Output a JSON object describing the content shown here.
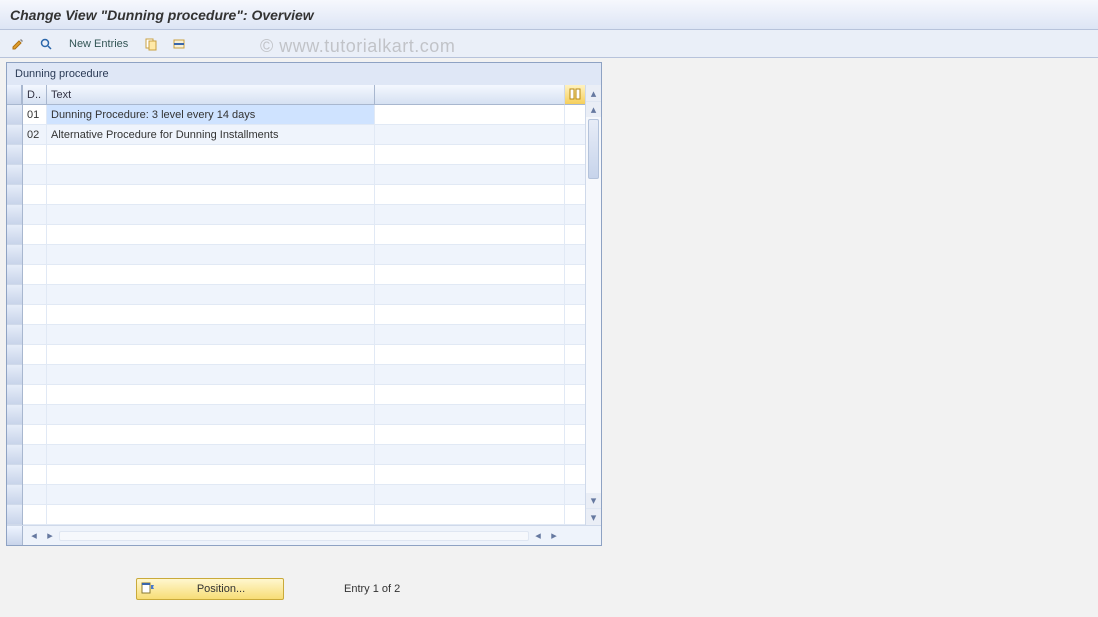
{
  "title": "Change View \"Dunning procedure\": Overview",
  "watermark": "© www.tutorialkart.com",
  "toolbar": {
    "new_entries_label": "New Entries"
  },
  "panel": {
    "title": "Dunning procedure"
  },
  "columns": {
    "d": "D..",
    "text": "Text"
  },
  "rows": [
    {
      "d": "01",
      "text": "Dunning Procedure: 3 level every 14 days",
      "selected": true
    },
    {
      "d": "02",
      "text": "Alternative Procedure for Dunning Installments",
      "selected": false
    }
  ],
  "empty_row_count": 19,
  "footer": {
    "position_label": "Position...",
    "entry_status": "Entry 1 of 2"
  }
}
